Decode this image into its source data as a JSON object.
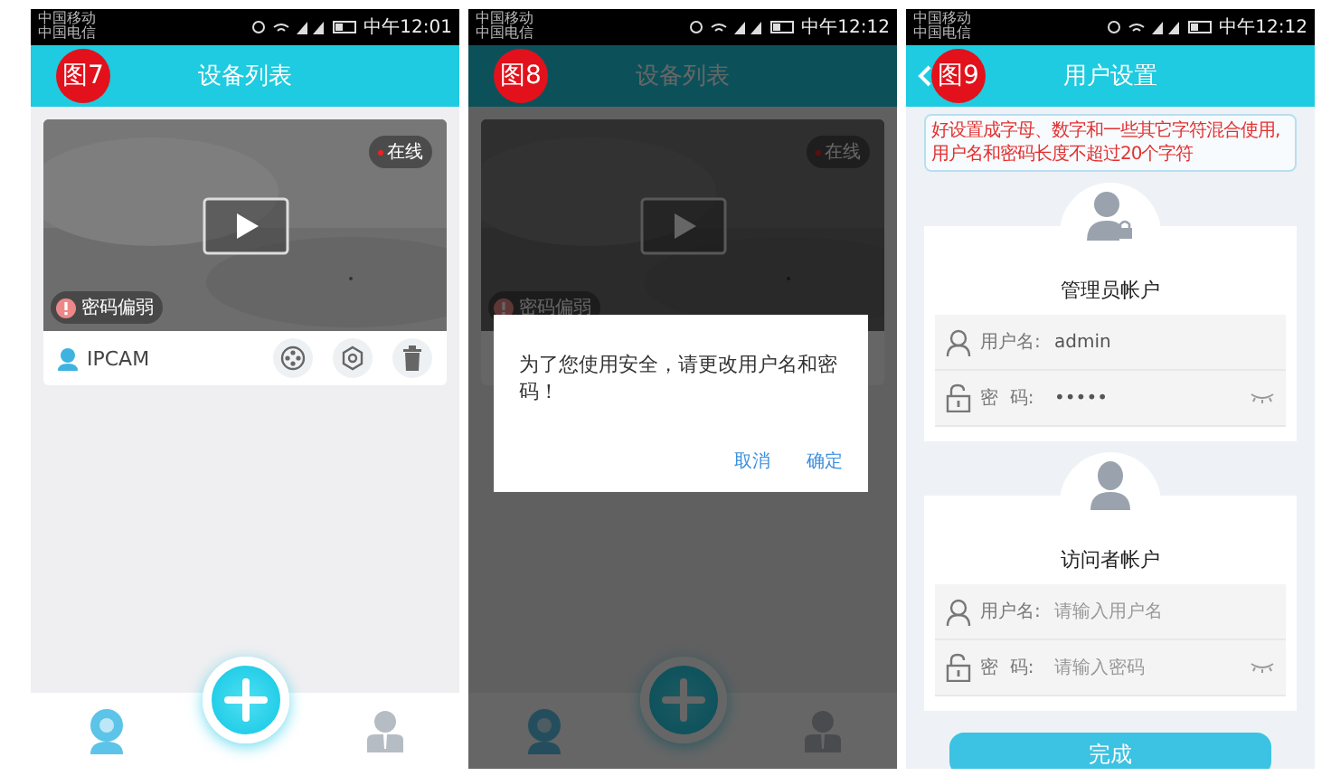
{
  "phones": [
    {
      "kind": "device_list",
      "badge": "图7",
      "carrier": [
        "中国移动",
        "中国电信"
      ],
      "time": "中午12:01",
      "title": "设备列表",
      "device": {
        "status": "在线",
        "warning": "密码偏弱",
        "name": "IPCAM"
      },
      "nav": [
        {
          "kind": "camera",
          "selected": true
        },
        {
          "kind": "add"
        },
        {
          "kind": "profile",
          "selected": false
        }
      ]
    },
    {
      "kind": "device_list",
      "badge": "图8",
      "carrier": [
        "中国移动",
        "中国电信"
      ],
      "time": "中午12:12",
      "title": "设备列表",
      "device": {
        "status": "在线",
        "warning": "密码偏弱"
      },
      "nav": [
        {
          "kind": "camera",
          "selected": true
        },
        {
          "kind": "add"
        },
        {
          "kind": "profile",
          "selected": false
        }
      ],
      "dialog": {
        "message": "为了您使用安全，请更改用户名和密码！",
        "buttons": [
          "取消",
          "确定"
        ]
      }
    },
    {
      "kind": "user_settings",
      "badge": "图9",
      "carrier": [
        "中国移动",
        "中国电信"
      ],
      "time": "中午12:12",
      "title": "用户设置",
      "notice": [
        "好设置成字母、数字和一些其它字符混合使用,",
        "用户名和密码长度不超过20个字符"
      ],
      "accounts": [
        {
          "kind": "admin",
          "title": "管理员帐户",
          "fields": [
            {
              "kind": "user",
              "label": "用户名:",
              "value": "admin"
            },
            {
              "kind": "password",
              "label": "密  码:",
              "value": "•••••"
            }
          ]
        },
        {
          "kind": "visitor",
          "title": "访问者帐户",
          "fields": [
            {
              "kind": "user",
              "label": "用户名:",
              "placeholder": "请输入用户名"
            },
            {
              "kind": "password",
              "label": "密  码:",
              "placeholder": "请输入密码"
            }
          ]
        }
      ],
      "submit": "完成"
    }
  ]
}
